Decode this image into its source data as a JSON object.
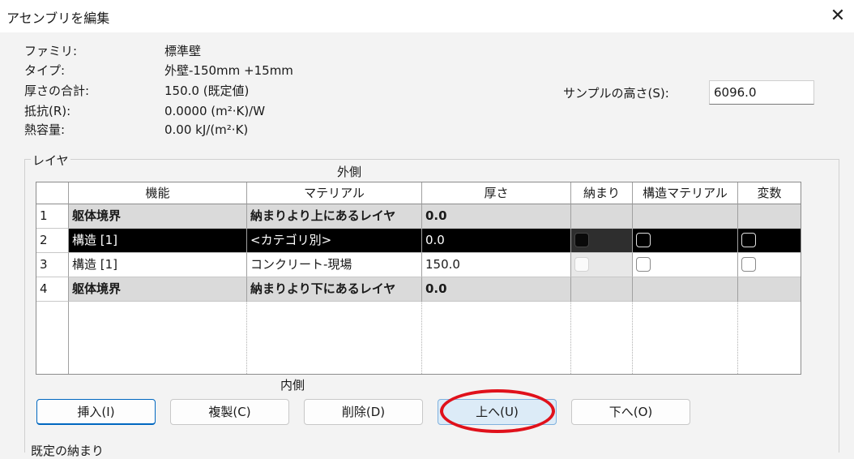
{
  "window": {
    "title": "アセンブリを編集",
    "close_glyph": "✕"
  },
  "properties": [
    {
      "label": "ファミリ:",
      "value": "標準壁"
    },
    {
      "label": "タイプ:",
      "value": "外壁-150mm +15mm"
    },
    {
      "label": "厚さの合計:",
      "value": "150.0 (既定値)"
    },
    {
      "label": "抵抗(R):",
      "value": "0.0000 (m²·K)/W"
    },
    {
      "label": "熱容量:",
      "value": "0.00 kJ/(m²·K)"
    }
  ],
  "sample_height": {
    "label": "サンプルの高さ(S):",
    "value": "6096.0"
  },
  "layers": {
    "group_label": "レイヤ",
    "outer_label": "外側",
    "inner_label": "内側",
    "columns": [
      "機能",
      "マテリアル",
      "厚さ",
      "納まり",
      "構造マテリアル",
      "変数"
    ],
    "rows": [
      {
        "num": "1",
        "function": "躯体境界",
        "material": "納まりより上にあるレイヤ",
        "thickness": "0.0"
      },
      {
        "num": "2",
        "function": "構造 [1]",
        "material": "<カテゴリ別>",
        "thickness": "0.0",
        "selected": true
      },
      {
        "num": "3",
        "function": "構造 [1]",
        "material": "コンクリート-現場",
        "thickness": "150.0"
      },
      {
        "num": "4",
        "function": "躯体境界",
        "material": "納まりより下にあるレイヤ",
        "thickness": "0.0"
      }
    ]
  },
  "buttons": {
    "insert": "挿入(I)",
    "duplicate": "複製(C)",
    "delete": "削除(D)",
    "up": "上へ(U)",
    "down": "下へ(O)"
  },
  "cut_label": "既定の納まり",
  "colors": {
    "accent": "#0067c0",
    "highlight_ring": "#e0111b",
    "selected_row": "#000000"
  }
}
